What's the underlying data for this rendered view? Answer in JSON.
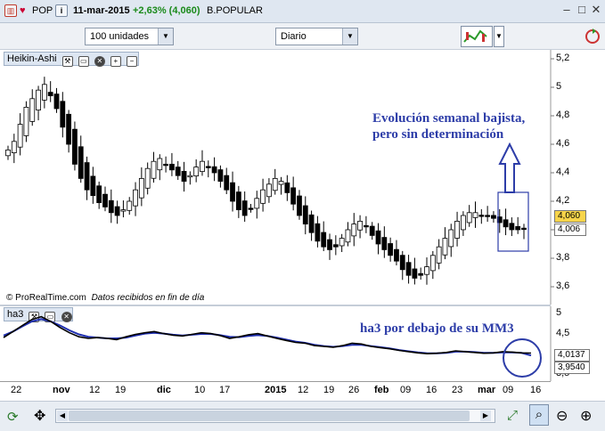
{
  "titlebar": {
    "symbol": "POP",
    "info_icon": "i",
    "date": "11-mar-2015",
    "change": "+2,63% (4,060)",
    "name": "B.POPULAR",
    "change_color": "#1a8a1a"
  },
  "toolbar": {
    "units_value": "100 unidades",
    "period_value": "Diario"
  },
  "price_panel": {
    "indicator_name": "Heikin-Ashi",
    "y_ticks": [
      "5,2",
      "5",
      "4,8",
      "4,6",
      "4,4",
      "4,2",
      "4",
      "3,8",
      "3,6"
    ],
    "last_price_tag": "4,060",
    "second_tag": "4,006",
    "credit": "© ProRealTime.com",
    "credit_note": "Datos recibidos en fin de día",
    "annotation_line1": "Evolución semanal bajista,",
    "annotation_line2": "pero sin determinación"
  },
  "ha3_panel": {
    "indicator_name": "ha3",
    "y_ticks": [
      "5",
      "4,5",
      "3,5"
    ],
    "tag_1": "4,0137",
    "tag_2": "3,9540",
    "annotation": "ha3 por debajo de su MM3"
  },
  "x_axis": {
    "labels": [
      "22",
      "nov",
      "12",
      "19",
      "dic",
      "10",
      "17",
      "2015",
      "12",
      "19",
      "26",
      "feb",
      "09",
      "16",
      "23",
      "mar",
      "09",
      "16"
    ]
  },
  "colors": {
    "up_candle": "#ffffff",
    "down_candle": "#000000",
    "annotation": "#2d3da8",
    "ma_line": "#1f2fb0"
  },
  "chart_data": {
    "type": "candlestick",
    "series": [
      {
        "name": "Heikin-Ashi",
        "close": [
          4.56,
          4.62,
          4.74,
          4.86,
          4.92,
          4.98,
          5.02,
          4.94,
          4.85,
          4.72,
          4.6,
          4.46,
          4.36,
          4.28,
          4.24,
          4.19,
          4.16,
          4.12,
          4.1,
          4.14,
          4.2,
          4.28,
          4.36,
          4.43,
          4.48,
          4.5,
          4.46,
          4.42,
          4.38,
          4.34,
          4.38,
          4.44,
          4.48,
          4.44,
          4.4,
          4.34,
          4.28,
          4.2,
          4.14,
          4.1,
          4.15,
          4.22,
          4.28,
          4.32,
          4.36,
          4.34,
          4.26,
          4.18,
          4.1,
          4.04,
          3.98,
          3.92,
          3.88,
          3.86,
          3.88,
          3.94,
          4.0,
          4.04,
          4.06,
          4.02,
          3.96,
          3.9,
          3.86,
          3.82,
          3.78,
          3.72,
          3.68,
          3.66,
          3.68,
          3.74,
          3.82,
          3.88,
          3.94,
          4.0,
          4.06,
          4.1,
          4.12,
          4.12,
          4.1,
          4.1,
          4.08,
          4.05,
          4.02,
          4.0,
          4.0,
          4.006
        ]
      },
      {
        "name": "ha3",
        "values": [
          4.4,
          4.55,
          4.7,
          4.85,
          4.92,
          4.8,
          4.65,
          4.52,
          4.42,
          4.38,
          4.4,
          4.38,
          4.35,
          4.42,
          4.48,
          4.52,
          4.55,
          4.5,
          4.46,
          4.44,
          4.48,
          4.52,
          4.5,
          4.45,
          4.38,
          4.42,
          4.47,
          4.5,
          4.44,
          4.38,
          4.33,
          4.28,
          4.26,
          4.2,
          4.18,
          4.16,
          4.2,
          4.26,
          4.24,
          4.18,
          4.15,
          4.12,
          4.08,
          4.05,
          4.02,
          4.0,
          4.01,
          4.03,
          4.07,
          4.05,
          4.03,
          4.01,
          4.02,
          4.05,
          4.04,
          4.02,
          4.0137
        ]
      },
      {
        "name": "MM3",
        "values": [
          4.45,
          4.55,
          4.68,
          4.8,
          4.86,
          4.8,
          4.7,
          4.58,
          4.48,
          4.42,
          4.4,
          4.38,
          4.38,
          4.4,
          4.45,
          4.5,
          4.52,
          4.5,
          4.47,
          4.45,
          4.47,
          4.49,
          4.49,
          4.46,
          4.42,
          4.41,
          4.44,
          4.46,
          4.44,
          4.4,
          4.35,
          4.3,
          4.27,
          4.22,
          4.19,
          4.17,
          4.19,
          4.22,
          4.22,
          4.19,
          4.16,
          4.13,
          4.09,
          4.06,
          4.03,
          4.01,
          4.01,
          4.02,
          4.05,
          4.05,
          4.04,
          4.02,
          4.02,
          4.03,
          4.03,
          4.02,
          3.954
        ]
      }
    ],
    "ylim": [
      3.5,
      5.25
    ],
    "ylim_ha3": [
      3.2,
      5.0
    ]
  }
}
